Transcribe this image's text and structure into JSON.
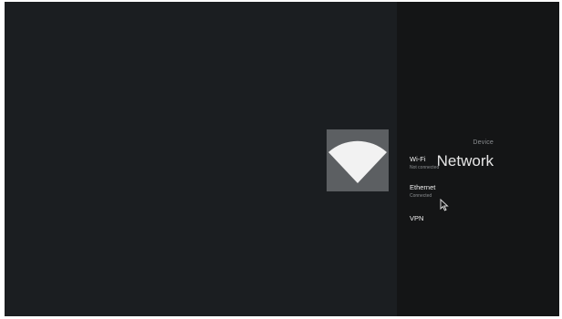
{
  "header": {
    "breadcrumb": "Device",
    "title": "Network"
  },
  "icon": {
    "name": "wifi-icon",
    "tile_color": "#5c5f62",
    "glyph_color": "#f2f2f2"
  },
  "menu": {
    "items": [
      {
        "label": "Wi-Fi",
        "status": "Not connected"
      },
      {
        "label": "Ethernet",
        "status": "Connected"
      },
      {
        "label": "VPN",
        "status": ""
      }
    ]
  },
  "colors": {
    "left_background": "#1b1e21",
    "right_background": "#141516"
  }
}
